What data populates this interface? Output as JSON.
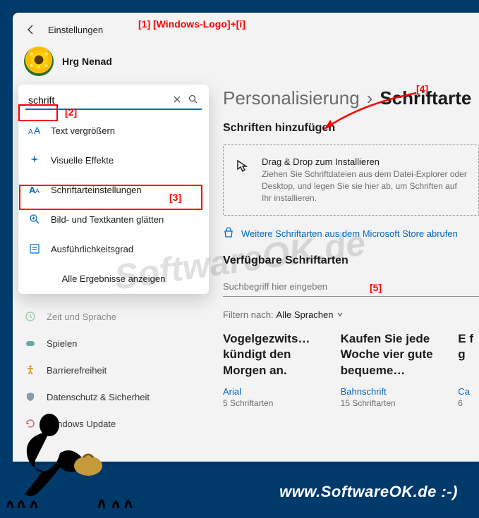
{
  "header": {
    "title": "Einstellungen"
  },
  "user": {
    "name": "Hrg Nenad"
  },
  "breadcrumb": {
    "parent": "Personalisierung",
    "sep": "›",
    "current": "Schriftarte"
  },
  "add_section": {
    "title": "Schriften hinzufügen"
  },
  "dropzone": {
    "title": "Drag & Drop zum Installieren",
    "desc": "Ziehen Sie Schriftdateien aus dem Datei-Explorer oder Desktop, und legen Sie sie hier ab, um Schriften auf Ihr installieren."
  },
  "store_link": "Weitere Schriftarten aus dem Microsoft Store abrufen",
  "available_section": {
    "title": "Verfügbare Schriftarten"
  },
  "font_search": {
    "placeholder": "Suchbegriff hier eingeben"
  },
  "filter": {
    "label": "Filtern nach:",
    "value": "Alle Sprachen"
  },
  "fonts": [
    {
      "preview": "Vogelgezwits… kündigt den Morgen an.",
      "name": "Arial",
      "count": "5 Schriftarten"
    },
    {
      "preview": "Kaufen Sie jede Woche vier gute bequeme…",
      "name": "Bahnschrift",
      "count": "15 Schriftarten"
    },
    {
      "preview": "E\nf\ng",
      "name": "Ca",
      "count": "6"
    }
  ],
  "search": {
    "value": "schrift"
  },
  "results": [
    {
      "icon": "text-size",
      "label": "Text vergrößern"
    },
    {
      "icon": "sparkle",
      "label": "Visuelle Effekte"
    },
    {
      "icon": "font",
      "label": "Schriftarteinstellungen"
    },
    {
      "icon": "magnify-plus",
      "label": "Bild- und Textkanten glätten"
    },
    {
      "icon": "detail",
      "label": "Ausführlichkeitsgrad"
    }
  ],
  "all_results": "Alle Ergebnisse anzeigen",
  "nav": [
    {
      "icon": "clock",
      "label": "Zeit und Sprache"
    },
    {
      "icon": "game",
      "label": "Spielen"
    },
    {
      "icon": "accessibility",
      "label": "Barrierefreiheit"
    },
    {
      "icon": "shield",
      "label": "Datenschutz & Sicherheit"
    },
    {
      "icon": "update",
      "label": "Windows Update"
    }
  ],
  "annotations": {
    "a1": "[1]  [Windows-Logo]+[i]",
    "a2": "[2]",
    "a3": "[3]",
    "a4": "[4]",
    "a5": "[5]"
  },
  "footer": "www.SoftwareOK.de :-)",
  "watermark": "SoftwareOK.de"
}
